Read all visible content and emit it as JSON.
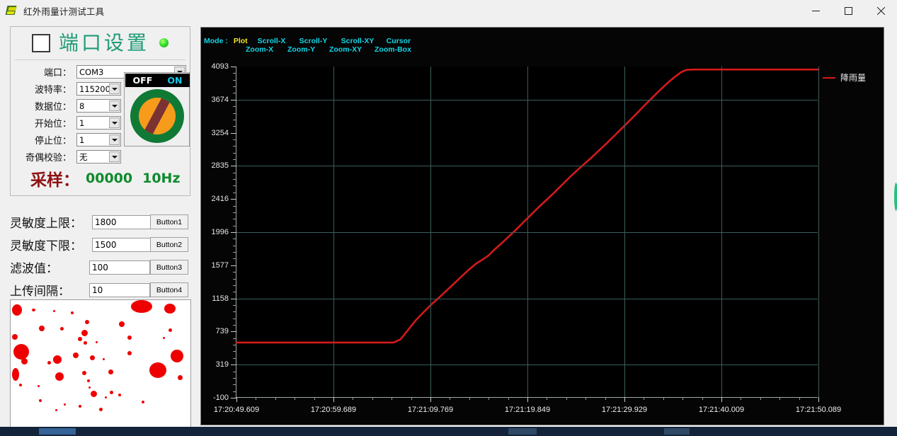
{
  "window": {
    "title": "红外雨量计测试工具",
    "icon": "app-icon",
    "minimize": "–",
    "maximize": "□",
    "close": "×"
  },
  "port_settings": {
    "title": "端口设置",
    "checkbox_checked": false,
    "led_color": "#2ee02e",
    "fields": [
      {
        "label": "端口：",
        "value": "COM3",
        "width": "wide"
      },
      {
        "label": "波特率：",
        "value": "115200",
        "width": "narrow"
      },
      {
        "label": "数据位：",
        "value": "8",
        "width": "narrow"
      },
      {
        "label": "开始位：",
        "value": "1",
        "width": "narrow"
      },
      {
        "label": "停止位：",
        "value": "1",
        "width": "narrow"
      },
      {
        "label": "奇偶校验：",
        "value": "无",
        "width": "narrow"
      }
    ],
    "switch": {
      "off_label": "OFF",
      "on_label": "ON",
      "state": "ON"
    },
    "sampling": {
      "label": "采样：",
      "count": "00000",
      "rate": "10Hz"
    }
  },
  "params": [
    {
      "label": "灵敏度上限：",
      "value": "1800",
      "button": "Button1"
    },
    {
      "label": "灵敏度下限：",
      "value": "1500",
      "button": "Button2"
    },
    {
      "label": "滤波值：",
      "value": "100",
      "button": "Button3"
    },
    {
      "label": "上传间隔：",
      "value": "10",
      "button": "Button4"
    }
  ],
  "image_panel": {
    "name": "rain-droplet-preview",
    "background": "#ffffff",
    "droplet_color": "#ee0000",
    "droplets": [
      [
        2,
        6,
        14,
        16
      ],
      [
        170,
        0,
        30,
        18
      ],
      [
        217,
        5,
        16,
        14
      ],
      [
        30,
        12,
        5,
        4
      ],
      [
        60,
        14,
        3,
        3
      ],
      [
        85,
        16,
        4,
        4
      ],
      [
        105,
        28,
        6,
        6
      ],
      [
        153,
        30,
        8,
        8
      ],
      [
        40,
        36,
        8,
        8
      ],
      [
        70,
        38,
        5,
        5
      ],
      [
        100,
        42,
        9,
        9
      ],
      [
        223,
        40,
        5,
        5
      ],
      [
        2,
        48,
        8,
        8
      ],
      [
        95,
        52,
        6,
        6
      ],
      [
        103,
        58,
        5,
        5
      ],
      [
        120,
        58,
        3,
        3
      ],
      [
        165,
        50,
        6,
        6
      ],
      [
        215,
        52,
        3,
        3
      ],
      [
        4,
        62,
        22,
        22
      ],
      [
        60,
        78,
        12,
        12
      ],
      [
        88,
        74,
        8,
        8
      ],
      [
        165,
        72,
        6,
        6
      ],
      [
        112,
        78,
        7,
        7
      ],
      [
        226,
        70,
        18,
        18
      ],
      [
        15,
        82,
        9,
        9
      ],
      [
        52,
        86,
        5,
        5
      ],
      [
        130,
        82,
        3,
        3
      ],
      [
        196,
        88,
        24,
        22
      ],
      [
        2,
        96,
        10,
        18
      ],
      [
        63,
        102,
        12,
        12
      ],
      [
        101,
        100,
        6,
        6
      ],
      [
        138,
        98,
        7,
        7
      ],
      [
        108,
        112,
        4,
        4
      ],
      [
        110,
        122,
        3,
        3
      ],
      [
        236,
        106,
        7,
        7
      ],
      [
        12,
        118,
        4,
        4
      ],
      [
        38,
        120,
        3,
        3
      ],
      [
        113,
        128,
        9,
        9
      ],
      [
        140,
        128,
        5,
        5
      ],
      [
        152,
        132,
        4,
        4
      ],
      [
        133,
        136,
        3,
        3
      ],
      [
        40,
        140,
        4,
        4
      ],
      [
        75,
        146,
        3,
        3
      ],
      [
        185,
        142,
        4,
        4
      ],
      [
        96,
        148,
        4,
        4
      ],
      [
        63,
        154,
        3,
        3
      ],
      [
        125,
        152,
        5,
        5
      ]
    ]
  },
  "chart_data": {
    "type": "line",
    "title": "",
    "xlabel": "",
    "ylabel": "",
    "background": "#000000",
    "grid": true,
    "grid_color": "#3b5d5c",
    "legend_position": "right",
    "series": [
      {
        "name": "降雨量",
        "color": "#d41a1a",
        "points": [
          [
            0,
            600
          ],
          [
            7,
            600
          ],
          [
            14,
            600
          ],
          [
            21,
            600
          ],
          [
            27,
            600
          ],
          [
            28.2,
            640
          ],
          [
            29.5,
            760
          ],
          [
            30.8,
            880
          ],
          [
            32.1,
            980
          ],
          [
            33.4,
            1075
          ],
          [
            34.7,
            1160
          ],
          [
            36.0,
            1250
          ],
          [
            37.3,
            1340
          ],
          [
            38.6,
            1430
          ],
          [
            39.9,
            1520
          ],
          [
            41.2,
            1600
          ],
          [
            42.5,
            1660
          ],
          [
            43.3,
            1700
          ],
          [
            44.1,
            1760
          ],
          [
            45.4,
            1845
          ],
          [
            46.7,
            1935
          ],
          [
            48.0,
            2025
          ],
          [
            49.3,
            2120
          ],
          [
            50.6,
            2215
          ],
          [
            51.9,
            2310
          ],
          [
            53.2,
            2400
          ],
          [
            54.5,
            2490
          ],
          [
            55.8,
            2585
          ],
          [
            57.1,
            2680
          ],
          [
            58.4,
            2770
          ],
          [
            59.7,
            2855
          ],
          [
            61.0,
            2940
          ],
          [
            62.3,
            3030
          ],
          [
            63.6,
            3120
          ],
          [
            64.9,
            3215
          ],
          [
            66.2,
            3310
          ],
          [
            67.5,
            3405
          ],
          [
            68.8,
            3500
          ],
          [
            70.1,
            3600
          ],
          [
            71.4,
            3695
          ],
          [
            72.7,
            3790
          ],
          [
            74.0,
            3880
          ],
          [
            75.3,
            3960
          ],
          [
            76.4,
            4020
          ],
          [
            77.3,
            4050
          ],
          [
            78.5,
            4055
          ],
          [
            82,
            4055
          ],
          [
            88,
            4055
          ],
          [
            94,
            4055
          ],
          [
            100,
            4055
          ]
        ]
      }
    ],
    "y_axis": {
      "min": -100,
      "max": 4093,
      "ticks": [
        4093,
        3674,
        3254,
        2835,
        2416,
        1996,
        1577,
        1158,
        739,
        319,
        -100
      ],
      "minor_per_interval": 4
    },
    "x_axis": {
      "ticks": [
        "17:20:49.609",
        "17:20:59.689",
        "17:21:09.769",
        "17:21:19.849",
        "17:21:29.929",
        "17:21:40.009",
        "17:21:50.089"
      ],
      "minor_per_interval": 4
    }
  },
  "chart_toolbar": {
    "mode_label": "Mode :",
    "active_mode": "Plot",
    "groups": [
      {
        "top": "Scroll-X",
        "bottom": "Zoom-X"
      },
      {
        "top": "Scroll-Y",
        "bottom": "Zoom-Y"
      },
      {
        "top": "Scroll-XY",
        "bottom": "Zoom-XY"
      },
      {
        "top": "Cursor",
        "bottom": "Zoom-Box"
      }
    ],
    "active_color": "#f2e71c",
    "item_color": "#13d7e8"
  }
}
